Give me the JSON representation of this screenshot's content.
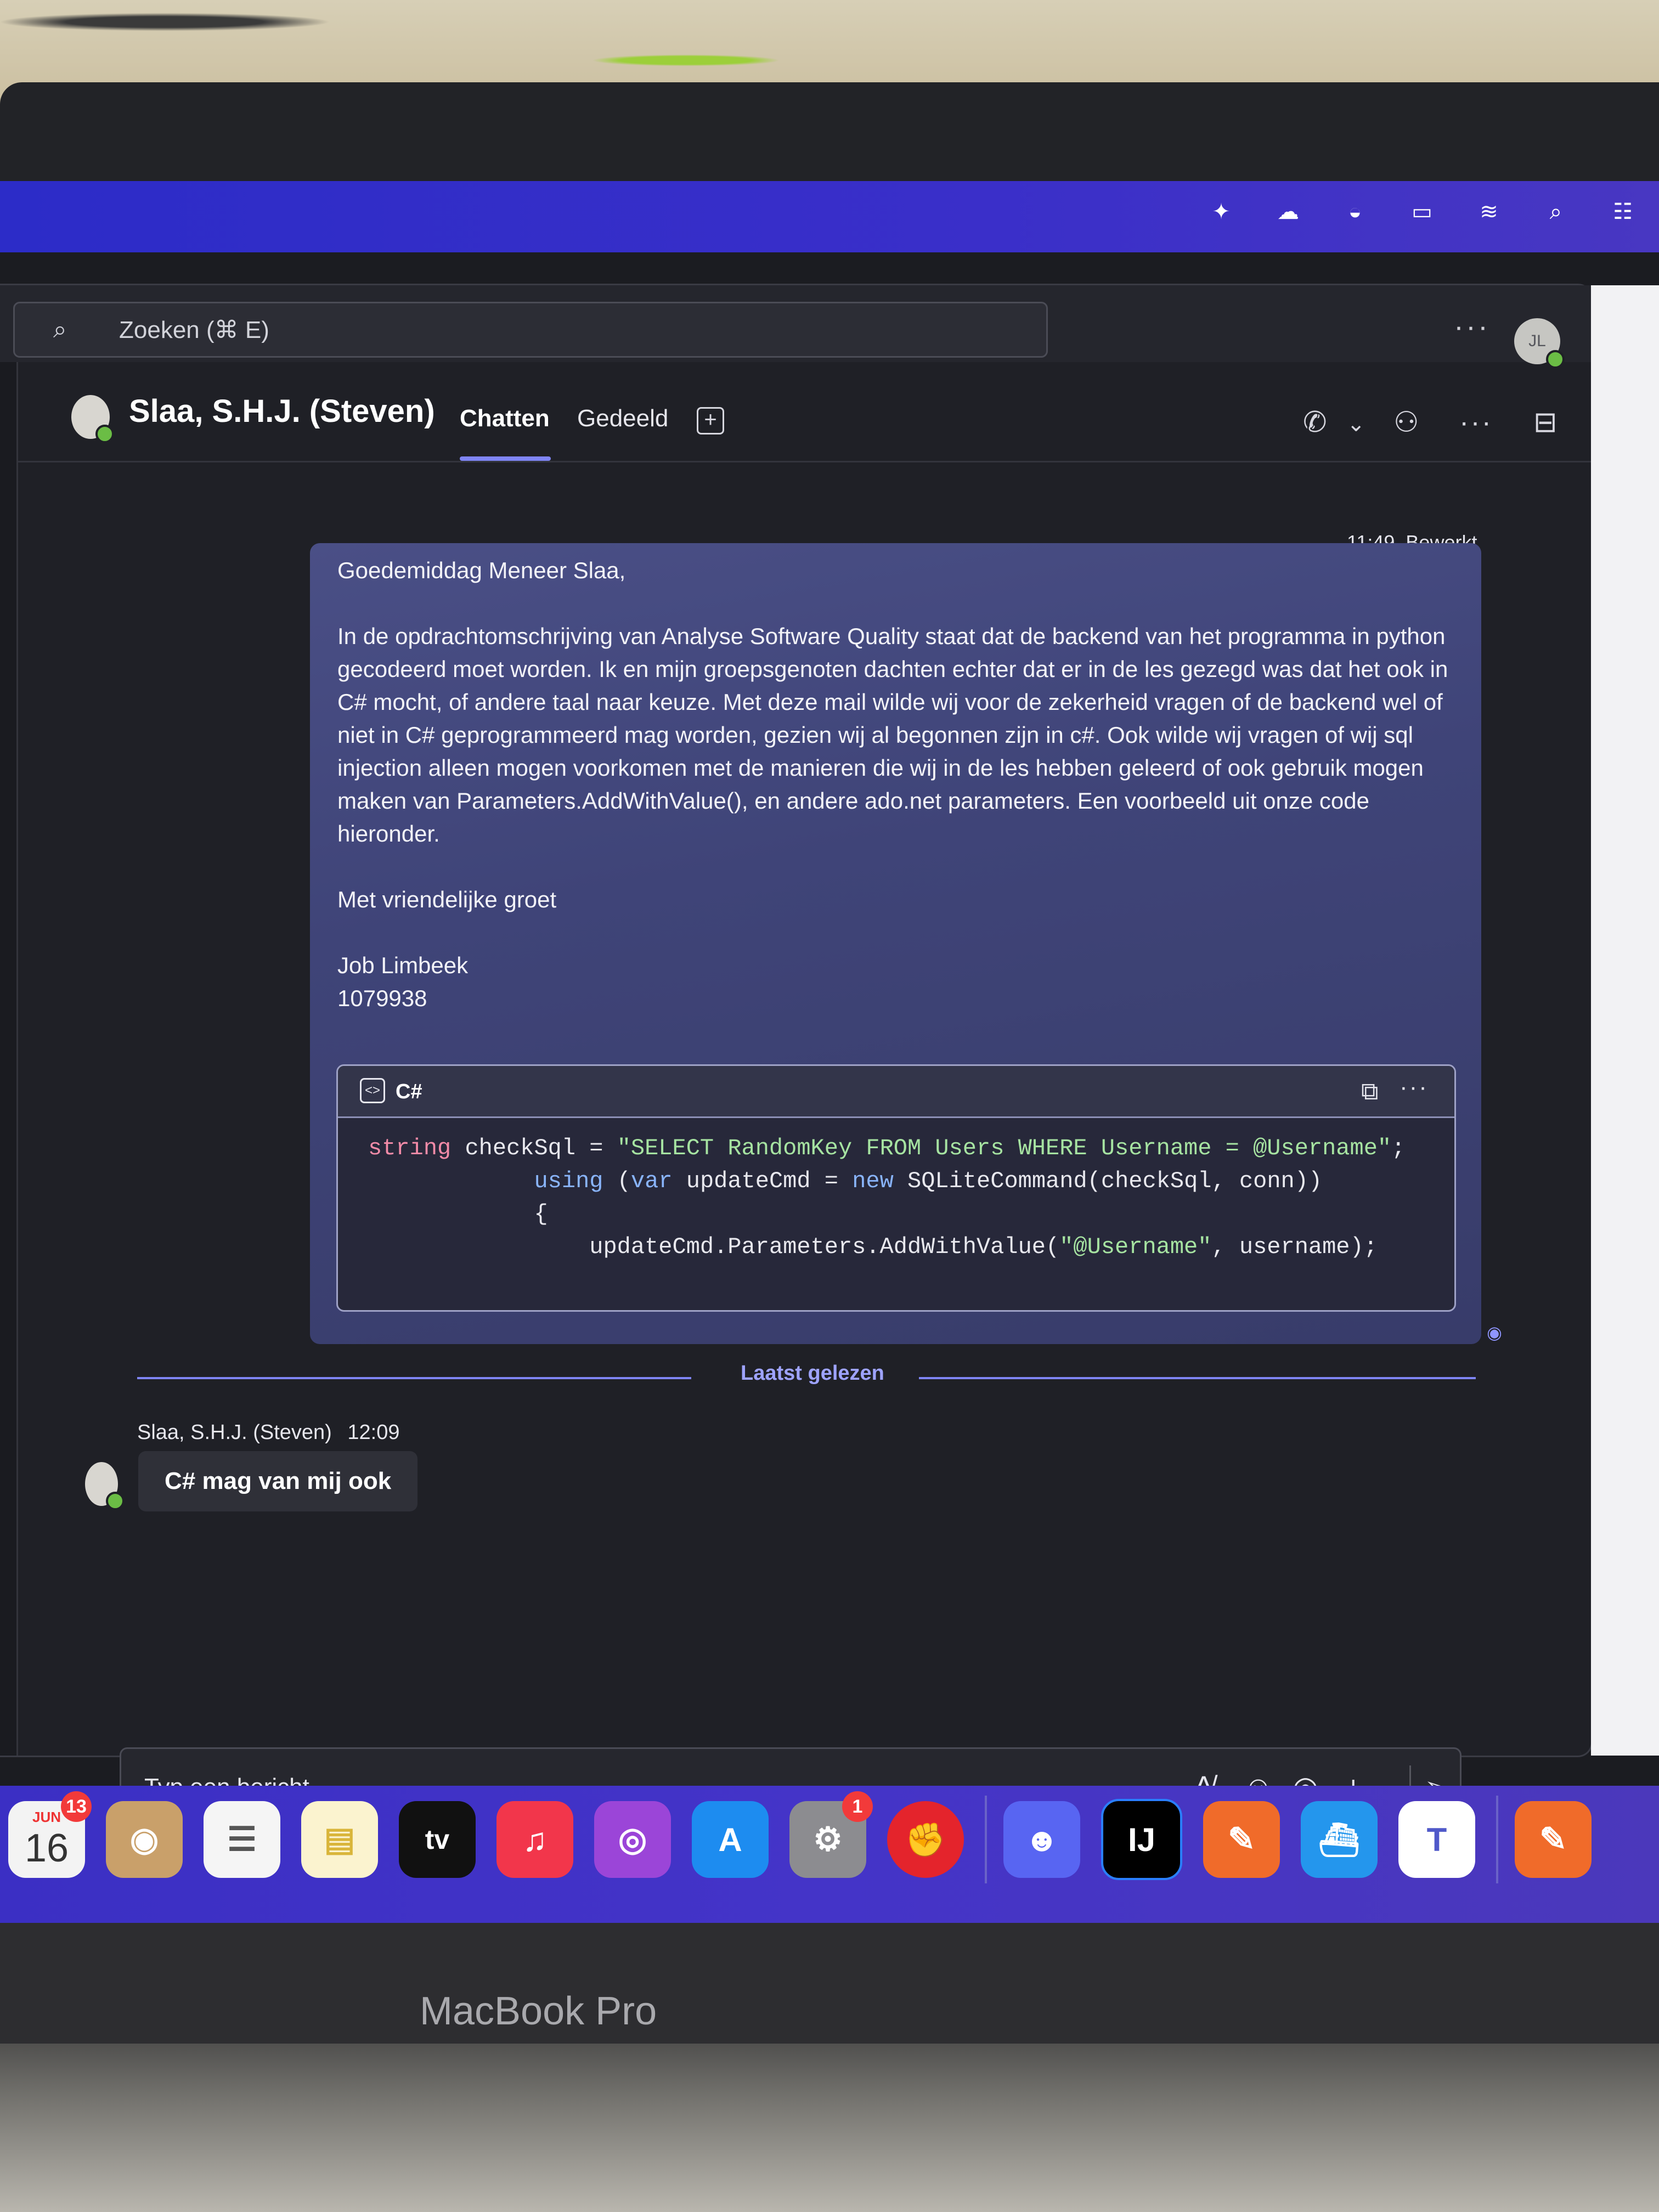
{
  "search": {
    "placeholder": "Zoeken (⌘ E)"
  },
  "account": {
    "initials": "JL"
  },
  "chat": {
    "title": "Slaa, S.H.J. (Steven)",
    "tabs": [
      {
        "label": "Chatten",
        "active": true
      },
      {
        "label": "Gedeeld",
        "active": false
      }
    ]
  },
  "message": {
    "time": "11:49",
    "edited_label": "Bewerkt",
    "greeting": "Goedemiddag Meneer Slaa,",
    "body": "In de opdrachtomschrijving van Analyse Software Quality staat dat de backend van het programma in python gecodeerd moet worden. Ik en mijn groepsgenoten dachten echter dat er in de les gezegd was dat het ook in C# mocht, of andere taal naar keuze. Met deze mail wilde wij voor de zekerheid vragen of de backend wel of niet in C# geprogrammeerd mag worden, gezien wij al begonnen zijn in c#. Ook wilde wij vragen of wij sql injection alleen mogen voorkomen met de manieren die wij in de les hebben geleerd of ook gebruik mogen maken van Parameters.AddWithValue(), en andere ado.net parameters. Een voorbeeld uit onze code hieronder.",
    "closing": "Met vriendelijke groet",
    "name": "Job Limbeek",
    "student_number": "1079938",
    "code": {
      "language": "C#",
      "lines": [
        "string checkSql = \"SELECT RandomKey FROM Users WHERE Username = @Username\";",
        "                using (var updateCmd = new SQLiteCommand(checkSql, conn))",
        "                {",
        "                    updateCmd.Parameters.AddWithValue(\"@Username\", username);"
      ]
    }
  },
  "divider": {
    "label": "Laatst gelezen"
  },
  "reply": {
    "sender": "Slaa, S.H.J. (Steven)",
    "time": "12:09",
    "text": "C# mag van mij ook"
  },
  "composer": {
    "placeholder": "Typ een bericht"
  },
  "dock": {
    "calendar_month": "JUN",
    "calendar_day": "16",
    "calendar_badge": "13",
    "settings_badge": "1",
    "tv_label": "tv"
  },
  "device": {
    "brand": "MacBook Pro"
  },
  "colors": {
    "accent": "#7f85f5",
    "menubar": "#2c2cc8",
    "bubble": "#444a80"
  }
}
